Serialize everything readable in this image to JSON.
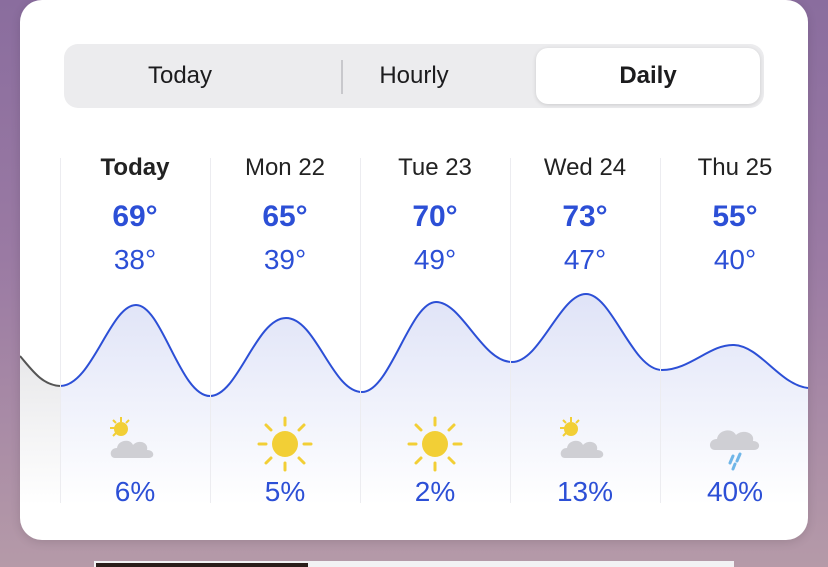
{
  "tabs": [
    {
      "label": "Today",
      "active": false
    },
    {
      "label": "Hourly",
      "active": false
    },
    {
      "label": "Daily",
      "active": true
    }
  ],
  "days": [
    {
      "name": "Today",
      "high": "69°",
      "low": "38°",
      "icon": "partly-sunny-cloud-icon",
      "precip": "6%"
    },
    {
      "name": "Mon 22",
      "high": "65°",
      "low": "39°",
      "icon": "sun-icon",
      "precip": "5%"
    },
    {
      "name": "Tue 23",
      "high": "70°",
      "low": "49°",
      "icon": "sun-icon",
      "precip": "2%"
    },
    {
      "name": "Wed 24",
      "high": "73°",
      "low": "47°",
      "icon": "partly-sunny-cloud-icon",
      "precip": "13%"
    },
    {
      "name": "Thu 25",
      "high": "55°",
      "low": "40°",
      "icon": "rain-cloud-icon",
      "precip": "40%"
    }
  ],
  "colors": {
    "accent": "#2c4fd6",
    "curve": "#2c4fd6",
    "sun": "#f2cf36",
    "cloud": "#cfcfd4",
    "rain": "#6fb6e8"
  }
}
